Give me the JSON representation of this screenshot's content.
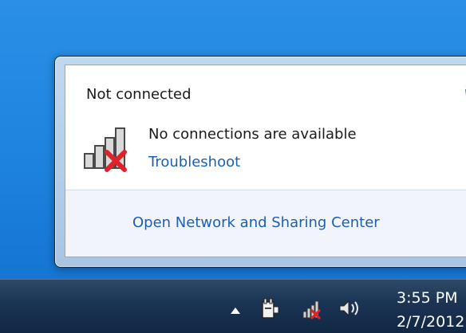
{
  "flyout": {
    "title": "Not connected",
    "message": "No connections are available",
    "troubleshoot_link": "Troubleshoot",
    "open_center_link": "Open Network and Sharing Center",
    "icons": [
      "refresh-icon",
      "network-no-connection-icon"
    ]
  },
  "taskbar": {
    "tray_icons": [
      "show-hidden-icons-chevron",
      "power-icon",
      "network-status-icon",
      "volume-icon"
    ],
    "clock_time": "3:55 PM",
    "clock_date": "2/7/2012"
  },
  "colors": {
    "link": "#1e5fb0",
    "error_x": "#e0202a",
    "desktop_blue": "#1f86e0",
    "taskbar": "#1c3554"
  }
}
